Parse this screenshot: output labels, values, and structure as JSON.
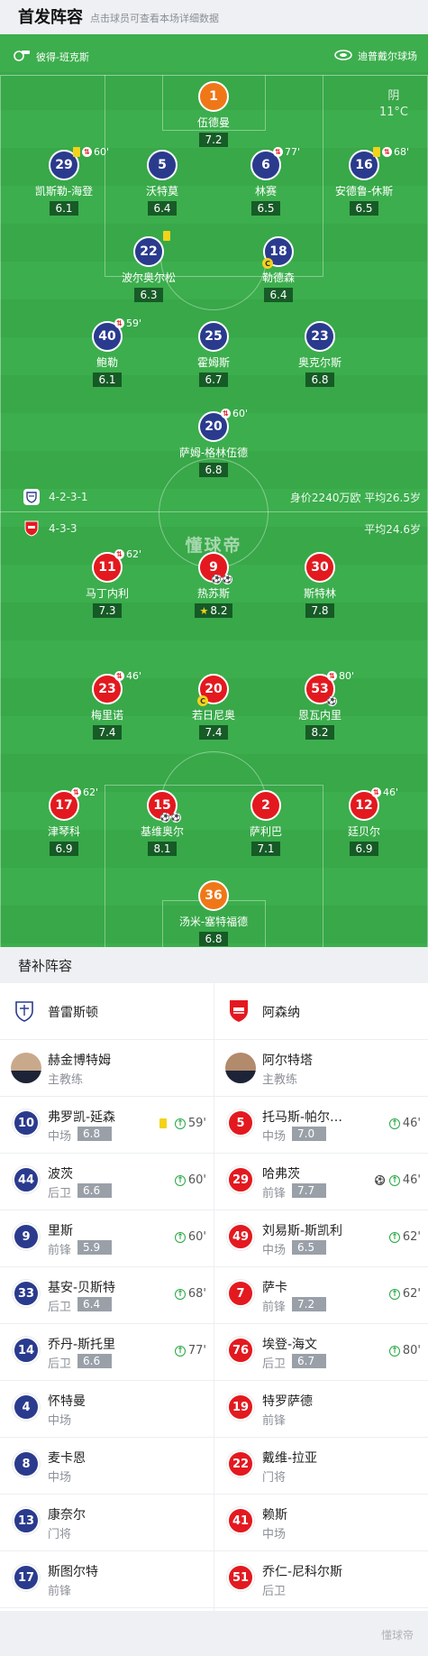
{
  "header": {
    "title": "首发阵容",
    "subtitle": "点击球员可查看本场详细数据"
  },
  "pitch": {
    "referee": "彼得-班克斯",
    "venue": "迪普戴尔球场",
    "weather": "阴",
    "temperature": "11°C",
    "watermark": "懂球帝",
    "home_team_bar": {
      "formation": "4-2-3-1",
      "info": "身价2240万欧 平均26.5岁"
    },
    "away_team_bar": {
      "formation": "4-3-3",
      "info": "平均24.6岁"
    }
  },
  "home_players": [
    {
      "num": "1",
      "name": "伍德曼",
      "rating": "7.2"
    },
    {
      "num": "29",
      "name": "凯斯勒-海登",
      "rating": "6.1",
      "card": true,
      "sub": "60'"
    },
    {
      "num": "5",
      "name": "沃特莫",
      "rating": "6.4"
    },
    {
      "num": "6",
      "name": "林赛",
      "rating": "6.5",
      "sub": "77'"
    },
    {
      "num": "16",
      "name": "安德鲁-休斯",
      "rating": "6.5",
      "card": true,
      "sub": "68'"
    },
    {
      "num": "22",
      "name": "波尔奥尔松",
      "rating": "6.3",
      "card": true
    },
    {
      "num": "18",
      "name": "勒德森",
      "rating": "6.4",
      "captain": "C"
    },
    {
      "num": "40",
      "name": "鲍勒",
      "rating": "6.1",
      "sub": "59'"
    },
    {
      "num": "25",
      "name": "霍姆斯",
      "rating": "6.7"
    },
    {
      "num": "23",
      "name": "奥克尔斯",
      "rating": "6.8"
    },
    {
      "num": "20",
      "name": "萨姆-格林伍德",
      "rating": "6.8",
      "sub": "60'"
    }
  ],
  "away_players": [
    {
      "num": "11",
      "name": "马丁内利",
      "rating": "7.3",
      "sub": "62'"
    },
    {
      "num": "9",
      "name": "热苏斯",
      "rating": "8.2",
      "star": true
    },
    {
      "num": "30",
      "name": "斯特林",
      "rating": "7.8"
    },
    {
      "num": "23",
      "name": "梅里诺",
      "rating": "7.4",
      "sub": "46'"
    },
    {
      "num": "20",
      "name": "若日尼奥",
      "rating": "7.4",
      "captain": "C"
    },
    {
      "num": "53",
      "name": "恩瓦内里",
      "rating": "8.2",
      "sub": "80'"
    },
    {
      "num": "17",
      "name": "津琴科",
      "rating": "6.9",
      "sub": "62'"
    },
    {
      "num": "15",
      "name": "基维奥尔",
      "rating": "8.1"
    },
    {
      "num": "2",
      "name": "萨利巴",
      "rating": "7.1"
    },
    {
      "num": "12",
      "name": "廷贝尔",
      "rating": "6.9",
      "sub": "46'"
    },
    {
      "num": "36",
      "name": "汤米-塞特福德",
      "rating": "6.8"
    }
  ],
  "bench": {
    "title": "替补阵容",
    "home_team": "普雷斯顿",
    "away_team": "阿森纳",
    "home_coach": {
      "name": "赫金博特姆",
      "role": "主教练"
    },
    "away_coach": {
      "name": "阿尔特塔",
      "role": "主教练"
    },
    "home": [
      {
        "num": "10",
        "name": "弗罗凯-延森",
        "pos": "中场",
        "rating": "6.8",
        "sub": "59'",
        "card": true
      },
      {
        "num": "44",
        "name": "波茨",
        "pos": "后卫",
        "rating": "6.6",
        "sub": "60'"
      },
      {
        "num": "9",
        "name": "里斯",
        "pos": "前锋",
        "rating": "5.9",
        "sub": "60'"
      },
      {
        "num": "33",
        "name": "基安-贝斯特",
        "pos": "后卫",
        "rating": "6.4",
        "sub": "68'"
      },
      {
        "num": "14",
        "name": "乔丹-斯托里",
        "pos": "后卫",
        "rating": "6.6",
        "sub": "77'"
      },
      {
        "num": "4",
        "name": "怀特曼",
        "pos": "中场"
      },
      {
        "num": "8",
        "name": "麦卡恩",
        "pos": "中场"
      },
      {
        "num": "13",
        "name": "康奈尔",
        "pos": "门将"
      },
      {
        "num": "17",
        "name": "斯图尔特",
        "pos": "前锋"
      }
    ],
    "away": [
      {
        "num": "5",
        "name": "托马斯-帕尔…",
        "pos": "中场",
        "rating": "7.0",
        "sub": "46'"
      },
      {
        "num": "29",
        "name": "哈弗茨",
        "pos": "前锋",
        "rating": "7.7",
        "sub": "46'",
        "goal": true
      },
      {
        "num": "49",
        "name": "刘易斯-斯凯利",
        "pos": "中场",
        "rating": "6.5",
        "sub": "62'"
      },
      {
        "num": "7",
        "name": "萨卡",
        "pos": "前锋",
        "rating": "7.2",
        "sub": "62'"
      },
      {
        "num": "76",
        "name": "埃登-海文",
        "pos": "后卫",
        "rating": "6.7",
        "sub": "80'"
      },
      {
        "num": "19",
        "name": "特罗萨德",
        "pos": "前锋"
      },
      {
        "num": "22",
        "name": "戴维-拉亚",
        "pos": "门将"
      },
      {
        "num": "41",
        "name": "赖斯",
        "pos": "中场"
      },
      {
        "num": "51",
        "name": "乔仁-尼科尔斯",
        "pos": "后卫"
      }
    ]
  },
  "footer_watermark": "懂球帝",
  "colors": {
    "home": "#2a3b8e",
    "away": "#e3191f",
    "keeper": "#f07718",
    "pitch": "#3cae4d",
    "card": "#f4d21a"
  }
}
